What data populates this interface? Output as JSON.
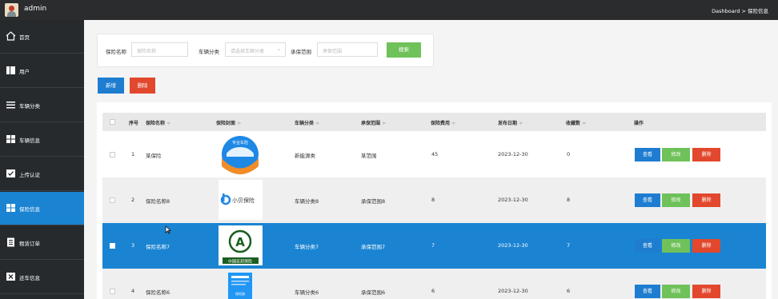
{
  "app": {
    "title": "admin",
    "breadcrumb": "Dashboard > 保险信息"
  },
  "sidebar": {
    "items": [
      {
        "label": "首页",
        "icon": "home-icon"
      },
      {
        "label": "用户",
        "icon": "user-icon"
      },
      {
        "label": "车辆分类",
        "icon": "list-icon"
      },
      {
        "label": "车辆信息",
        "icon": "grid-icon"
      },
      {
        "label": "上传认证",
        "icon": "check-icon"
      },
      {
        "label": "保险信息",
        "icon": "grid-icon",
        "active": true
      },
      {
        "label": "租赁订单",
        "icon": "document-icon"
      },
      {
        "label": "还车信息",
        "icon": "x-box-icon"
      }
    ]
  },
  "search": {
    "name_label": "保险名称",
    "name_placeholder": "保险名称",
    "category_label": "车辆分类",
    "category_placeholder": "请选择车辆分类",
    "scope_label": "承保范围",
    "scope_placeholder": "承保范围",
    "search_button": "搜索"
  },
  "toolbar": {
    "add_label": "新增",
    "delete_label": "删除"
  },
  "table": {
    "headers": [
      "序号",
      "保险名称",
      "保险封面",
      "车辆分类",
      "承保范围",
      "保险费用",
      "发布日期",
      "收藏数",
      "操作"
    ],
    "actions": {
      "view": "查看",
      "edit": "修改",
      "delete": "删除"
    },
    "rows": [
      {
        "index": "1",
        "name": "某保险",
        "cover": "专业车险",
        "category": "新能源类",
        "scope": "某范围",
        "fee": "45",
        "date": "2023-12-30",
        "favorites": "0"
      },
      {
        "index": "2",
        "name": "保险名称8",
        "cover": "小贝保险",
        "category": "车辆分类8",
        "scope": "承保范围8",
        "fee": "8",
        "date": "2023-12-30",
        "favorites": "8"
      },
      {
        "index": "3",
        "name": "保险名称7",
        "cover": "中国安邦保险",
        "category": "车辆分类7",
        "scope": "承保范围7",
        "fee": "7",
        "date": "2023-12-30",
        "favorites": "7"
      },
      {
        "index": "4",
        "name": "保险名称6",
        "cover": "保险册",
        "category": "车辆分类6",
        "scope": "承保范围6",
        "fee": "6",
        "date": "2023-12-30",
        "favorites": "6"
      }
    ]
  },
  "colors": {
    "sidebar": "#262a2d",
    "active": "#1a84d2",
    "primary": "#1e7dd0",
    "success": "#6fc15a",
    "danger": "#e2482d",
    "topbar": "#2a2c2e"
  }
}
